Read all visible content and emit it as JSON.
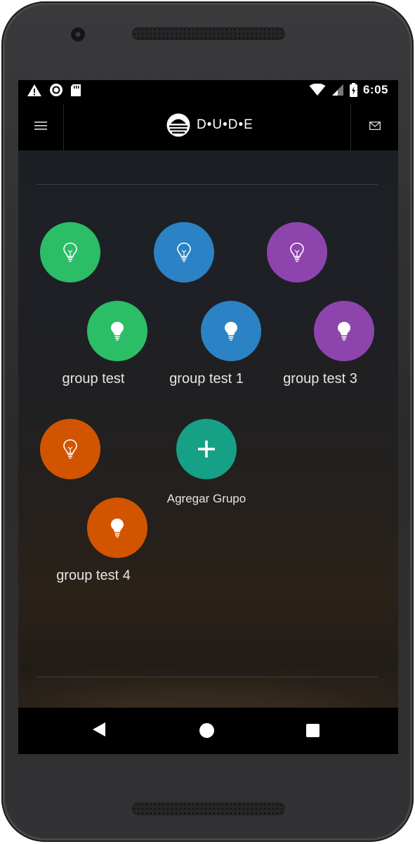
{
  "status_bar": {
    "time": "6:05",
    "left_icons": [
      "warning-icon",
      "sync-icon",
      "sd-card-icon"
    ],
    "right_icons": [
      "wifi-icon",
      "cell-signal-icon",
      "battery-charging-icon"
    ]
  },
  "app_bar": {
    "title": "D•U•D•E",
    "menu_icon": "hamburger-menu-icon",
    "mail_icon": "mail-icon"
  },
  "groups": [
    {
      "label": "group test",
      "color": "#2cbd67",
      "icon": "lightbulb-icon"
    },
    {
      "label": "group test 1",
      "color": "#2b82c4",
      "icon": "lightbulb-icon"
    },
    {
      "label": "group test 3",
      "color": "#8e44ad",
      "icon": "lightbulb-icon"
    },
    {
      "label": "group test 4",
      "color": "#d35400",
      "icon": "lightbulb-icon"
    }
  ],
  "add_group": {
    "label": "Agregar Grupo",
    "color": "#16a085",
    "icon": "plus-icon"
  },
  "nav_bar": {
    "back": "back-icon",
    "home": "home-icon",
    "recents": "recents-icon"
  }
}
